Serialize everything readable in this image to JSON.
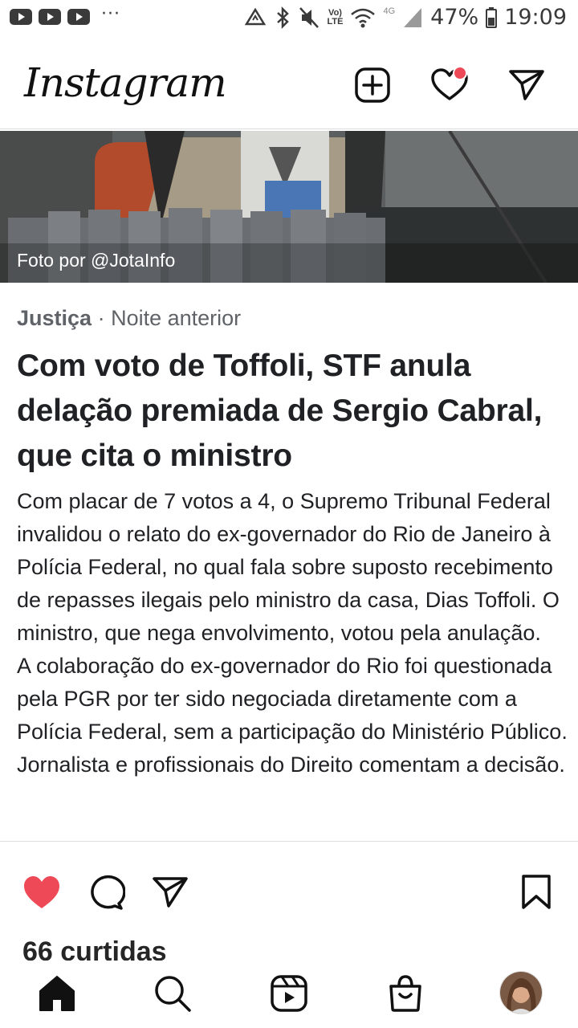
{
  "status_bar": {
    "battery": "47%",
    "time": "19:09",
    "network_label": "Vo)\nLTE",
    "network_type": "4G",
    "icons": [
      "youtube-icon",
      "youtube-icon",
      "youtube-icon",
      "more-dots-icon",
      "data-saver-icon",
      "bluetooth-icon",
      "mute-icon",
      "volte-icon",
      "wifi-icon",
      "signal-icon",
      "battery-icon"
    ]
  },
  "header": {
    "logo": "Instagram",
    "icons": [
      "new-post-icon",
      "activity-heart-icon",
      "direct-message-icon"
    ],
    "notification_color": "#ed4956"
  },
  "post": {
    "photo_credit": "Foto por @JotaInfo",
    "category": "Justiça",
    "time_ago": "· Noite anterior",
    "title": "Com voto de Toffoli, STF anula delação premiada de Sergio Cabral, que cita o ministro",
    "paragraph_1": "Com placar de 7 votos a 4, o Supremo Tribunal Federal invalidou o relato do ex-governador do Rio de Janeiro à Polícia Federal, no qual fala sobre suposto recebimento de repasses ilegais pelo ministro da casa, Dias Toffoli. O ministro, que nega envolvimento, votou pela anulação.",
    "paragraph_2": "A colaboração do ex-governador do Rio foi questionada pela PGR por ter sido negociada diretamente com a Polícia Federal, sem a participação do Ministério Público. Jornalista e profissionais do Direito comentam a decisão.",
    "likes": "66 curtidas",
    "like_color": "#ed4956"
  },
  "bottom_nav": {
    "items": [
      "home-icon",
      "search-icon",
      "reels-icon",
      "shop-icon",
      "profile-avatar"
    ]
  }
}
